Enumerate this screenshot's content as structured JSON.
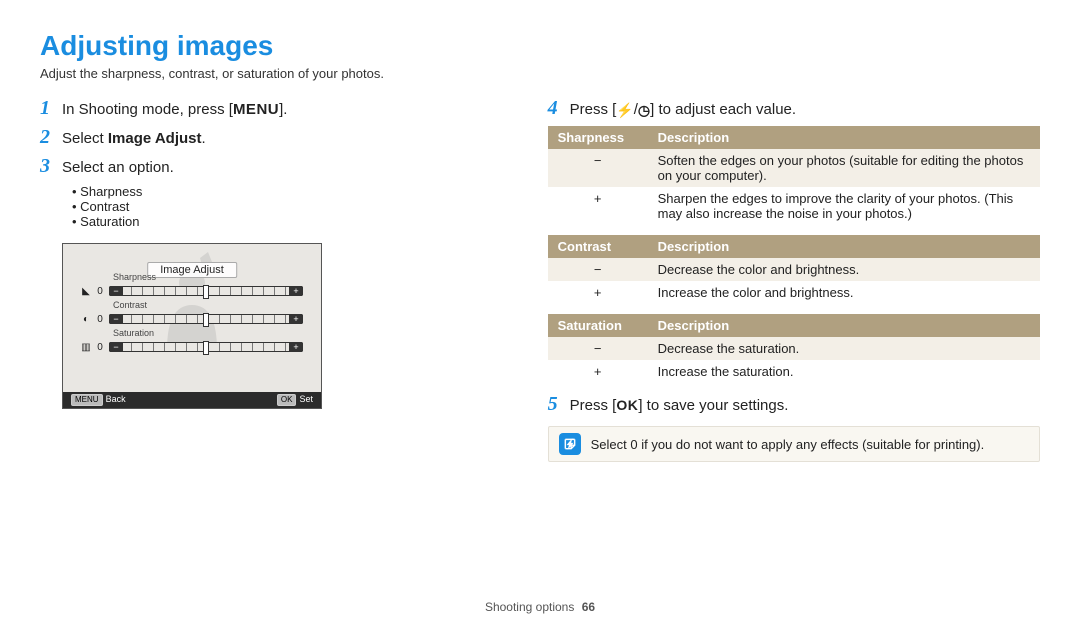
{
  "title": "Adjusting images",
  "intro": "Adjust the sharpness, contrast, or saturation of your photos.",
  "steps": {
    "s1_pre": "In Shooting mode, press [",
    "s1_menu": "MENU",
    "s1_post": "].",
    "s2_pre": "Select ",
    "s2_bold": "Image Adjust",
    "s2_post": ".",
    "s3": "Select an option.",
    "s4_pre": "Press [",
    "s4_mid": "/",
    "s4_post": "] to adjust each value.",
    "s5_pre": "Press [",
    "s5_ok": "OK",
    "s5_post": "] to save your settings."
  },
  "sub_options": [
    "Sharpness",
    "Contrast",
    "Saturation"
  ],
  "lcd": {
    "title": "Image Adjust",
    "rows": [
      {
        "label": "Sharpness",
        "value": "0"
      },
      {
        "label": "Contrast",
        "value": "0"
      },
      {
        "label": "Saturation",
        "value": "0"
      }
    ],
    "back_tag": "MENU",
    "back": "Back",
    "set_tag": "OK",
    "set": "Set"
  },
  "tables": {
    "sharpness": {
      "h1": "Sharpness",
      "h2": "Description",
      "rows": [
        {
          "k": "−",
          "v": "Soften the edges on your photos (suitable for editing the photos on your computer)."
        },
        {
          "k": "+",
          "v": "Sharpen the edges to improve the clarity of your photos. (This may also increase the noise in your photos.)"
        }
      ]
    },
    "contrast": {
      "h1": "Contrast",
      "h2": "Description",
      "rows": [
        {
          "k": "−",
          "v": "Decrease the color and brightness."
        },
        {
          "k": "+",
          "v": "Increase the color and brightness."
        }
      ]
    },
    "saturation": {
      "h1": "Saturation",
      "h2": "Description",
      "rows": [
        {
          "k": "−",
          "v": "Decrease the saturation."
        },
        {
          "k": "+",
          "v": "Increase the saturation."
        }
      ]
    }
  },
  "note": "Select 0 if you do not want to apply any effects (suitable for printing).",
  "footer": {
    "section": "Shooting options",
    "page": "66"
  }
}
